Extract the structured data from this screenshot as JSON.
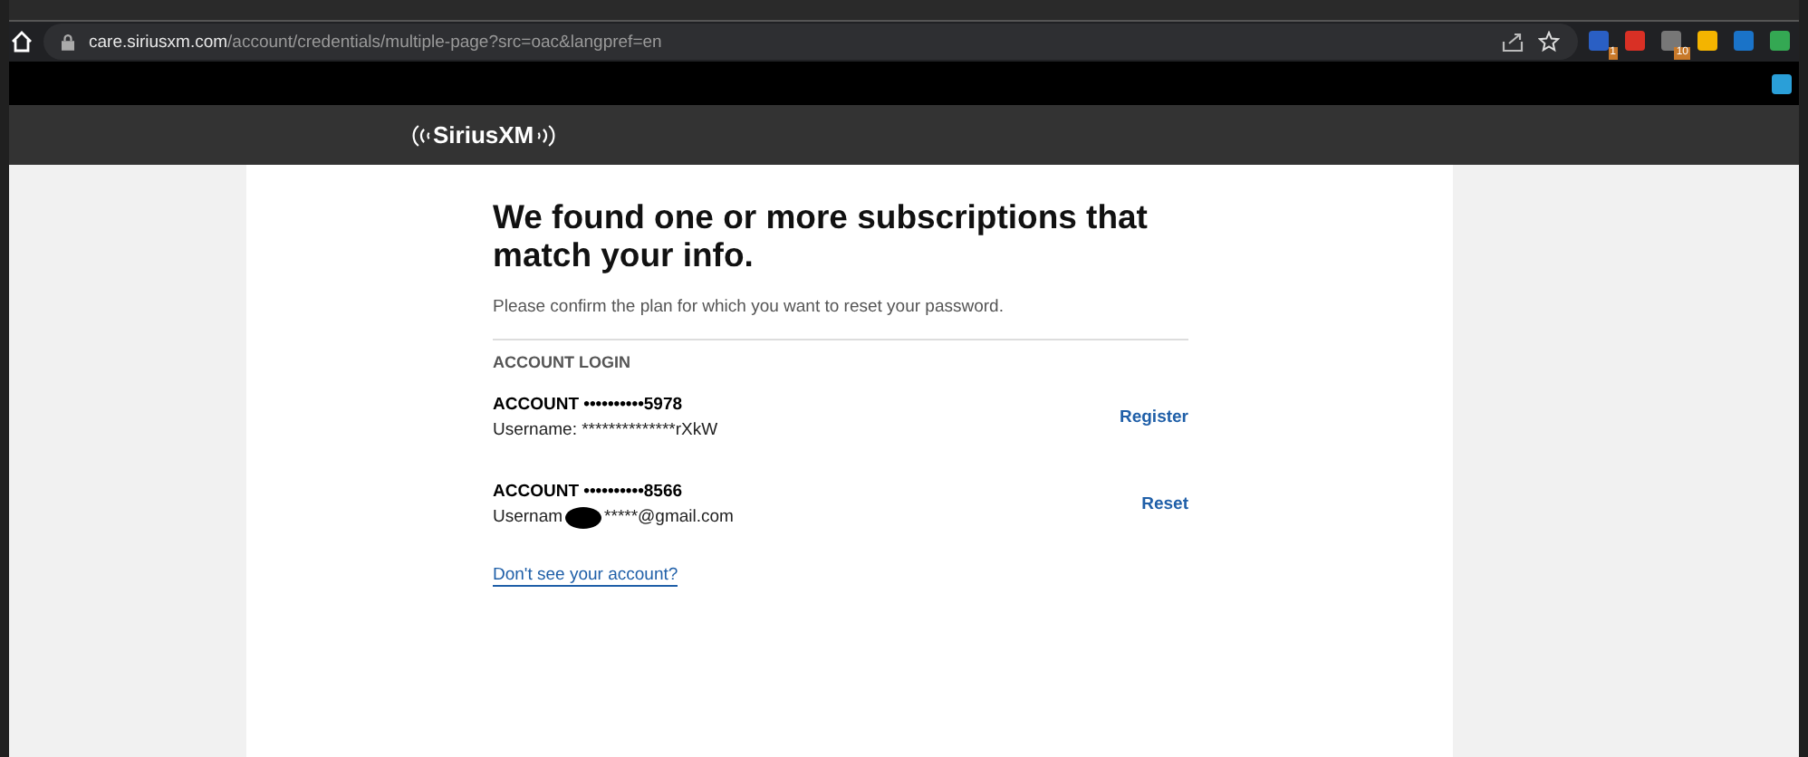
{
  "browser": {
    "url_host": "care.siriusxm.com",
    "url_path": "/account/credentials/multiple-page?src=oac&langpref=en",
    "extensions": [
      {
        "color": "#2a5fc4",
        "badge": "1"
      },
      {
        "color": "#d93025"
      },
      {
        "color": "#777777",
        "badge": "10"
      },
      {
        "color": "#f4b400"
      },
      {
        "color": "#1a73c8"
      },
      {
        "color": "#34a853"
      }
    ],
    "bookmark_extension": {
      "color": "#2a9fd8"
    }
  },
  "header": {
    "logo": "SiriusXM"
  },
  "page": {
    "title": "We found one or more subscriptions that match your info.",
    "subtitle": "Please confirm the plan for which you want to reset your password.",
    "section": "ACCOUNT LOGIN",
    "accounts": [
      {
        "account": "ACCOUNT ••••••••••5978",
        "username": [
          "Username: **************rXkW"
        ],
        "redacted": false,
        "action": "Register"
      },
      {
        "account": "ACCOUNT ••••••••••8566",
        "username": [
          "Usernam",
          "*****@gmail.com"
        ],
        "redacted": true,
        "action": "Reset"
      }
    ],
    "help_link": "Don't see your account?"
  }
}
